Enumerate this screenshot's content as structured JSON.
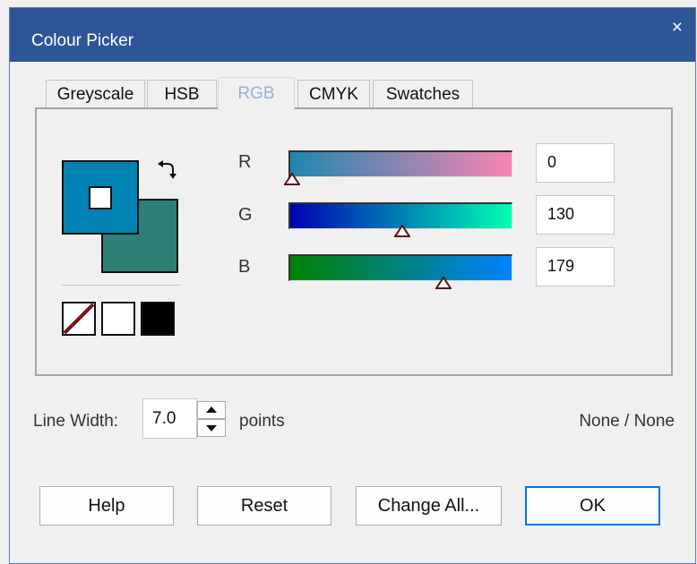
{
  "window": {
    "title": "Colour Picker",
    "close_glyph": "×"
  },
  "tabs": [
    {
      "label": "Greyscale",
      "active": false
    },
    {
      "label": "HSB",
      "active": false
    },
    {
      "label": "RGB",
      "active": true
    },
    {
      "label": "CMYK",
      "active": false
    },
    {
      "label": "Swatches",
      "active": false
    }
  ],
  "colours": {
    "foreground": "#0082b3",
    "background": "#2e8077"
  },
  "channels": [
    {
      "label": "R",
      "value": "0",
      "fraction": 0.0,
      "gradient": [
        "#1f86ad",
        "#f885b3"
      ]
    },
    {
      "label": "G",
      "value": "130",
      "fraction": 0.51,
      "gradient": [
        "#0002b3",
        "#00ffb3"
      ]
    },
    {
      "label": "B",
      "value": "179",
      "fraction": 0.7,
      "gradient": [
        "#008200",
        "#0082ff"
      ]
    }
  ],
  "line_width": {
    "label": "Line Width:",
    "value": "7.0",
    "unit": "points"
  },
  "status": "None / None",
  "buttons": {
    "help": "Help",
    "reset": "Reset",
    "change_all": "Change All...",
    "ok": "OK"
  }
}
